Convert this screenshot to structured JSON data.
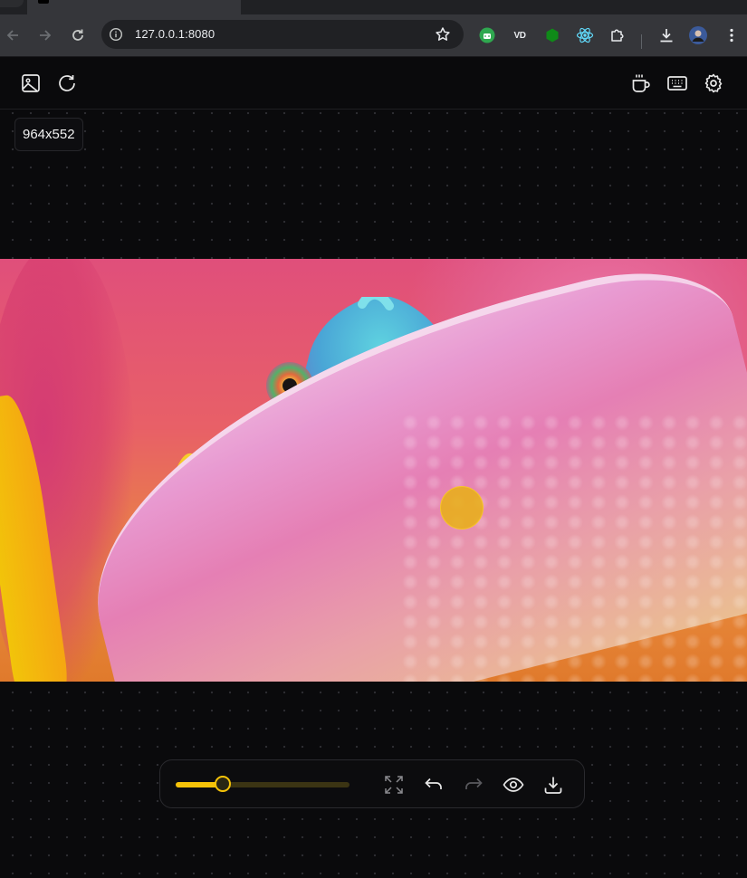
{
  "browser": {
    "url": "127.0.0.1:8080",
    "extensions": [
      "android-icon",
      "vd-extension-icon",
      "green-extension-icon",
      "react-devtools-icon",
      "puzzle-icon"
    ],
    "extension_vd_label": "VD"
  },
  "header": {
    "left_buttons": [
      "open-image-icon",
      "reload-icon"
    ],
    "right_buttons": [
      "coffee-icon",
      "keyboard-icon",
      "settings-icon"
    ]
  },
  "image": {
    "dimensions_label": "964x552"
  },
  "brush": {
    "size_fraction": 0.27,
    "color": "#e8b014"
  },
  "bottom_toolbar": {
    "buttons": [
      "fullscreen-icon",
      "undo-icon",
      "redo-icon",
      "eye-icon",
      "download-icon"
    ],
    "redo_enabled": false
  },
  "colors": {
    "accent": "#f6c308",
    "background": "#0a0a0c"
  }
}
